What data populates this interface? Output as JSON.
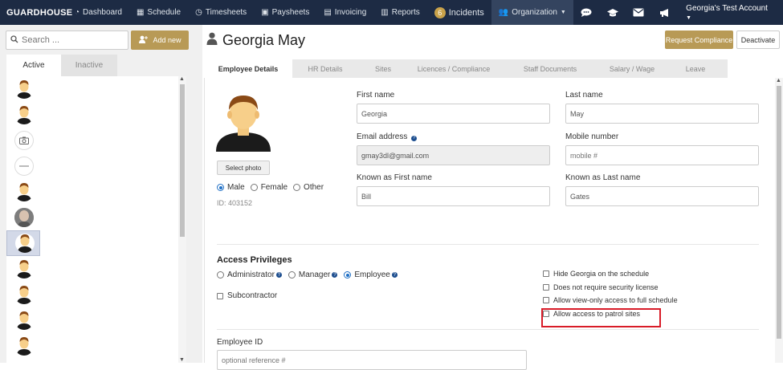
{
  "nav": {
    "brand": "GUARDHOUSE",
    "items": [
      {
        "label": "Dashboard",
        "icon": "dashboard-icon"
      },
      {
        "label": "Schedule",
        "icon": "calendar-icon"
      },
      {
        "label": "Timesheets",
        "icon": "clock-icon"
      },
      {
        "label": "Paysheets",
        "icon": "money-icon"
      },
      {
        "label": "Invoicing",
        "icon": "invoice-icon"
      },
      {
        "label": "Reports",
        "icon": "reports-icon"
      },
      {
        "label": "Incidents",
        "icon": "incidents-icon",
        "badge": "6"
      },
      {
        "label": "Organization",
        "icon": "users-icon",
        "dropdown": true
      }
    ],
    "right_icons": [
      "chat-icon",
      "graduation-cap-icon",
      "mail-icon",
      "megaphone-icon"
    ],
    "account": "Georgia's Test Account"
  },
  "sidebar": {
    "search_placeholder": "Search ...",
    "add_new": "Add new",
    "tabs": [
      "Active",
      "Inactive"
    ],
    "users": [
      {
        "type": "default"
      },
      {
        "type": "default"
      },
      {
        "type": "camera"
      },
      {
        "type": "other"
      },
      {
        "type": "default"
      },
      {
        "type": "photo"
      },
      {
        "type": "default",
        "selected": true
      },
      {
        "type": "default"
      },
      {
        "type": "default"
      },
      {
        "type": "default"
      },
      {
        "type": "default"
      }
    ]
  },
  "header": {
    "name": "Georgia May",
    "request_compliance": "Request Compliance",
    "deactivate": "Deactivate"
  },
  "tabs": [
    "Employee Details",
    "HR Details",
    "Sites",
    "Licences / Compliance",
    "Staff Documents",
    "Salary / Wage",
    "Leave"
  ],
  "profile": {
    "select_photo": "Select photo",
    "gender_options": [
      "Male",
      "Female",
      "Other"
    ],
    "gender_selected": "Male",
    "id_text": "ID: 403152"
  },
  "fields": {
    "first_name_label": "First name",
    "first_name_value": "Georgia",
    "last_name_label": "Last name",
    "last_name_value": "May",
    "email_label": "Email address",
    "email_value": "gmay3dl@gmail.com",
    "mobile_label": "Mobile number",
    "mobile_placeholder": "mobile #",
    "known_first_label": "Known as First name",
    "known_first_value": "Bill",
    "known_last_label": "Known as Last name",
    "known_last_value": "Gates"
  },
  "access": {
    "title": "Access Privileges",
    "roles": [
      "Administrator",
      "Manager",
      "Employee"
    ],
    "role_selected": "Employee",
    "subcontractor": "Subcontractor",
    "options": [
      "Hide Georgia on the schedule",
      "Does not require security license",
      "Allow view-only access to full schedule",
      "Allow access to patrol sites"
    ],
    "highlight_color": "#d81c28"
  },
  "employee_id": {
    "label": "Employee ID",
    "placeholder": "optional reference #"
  }
}
